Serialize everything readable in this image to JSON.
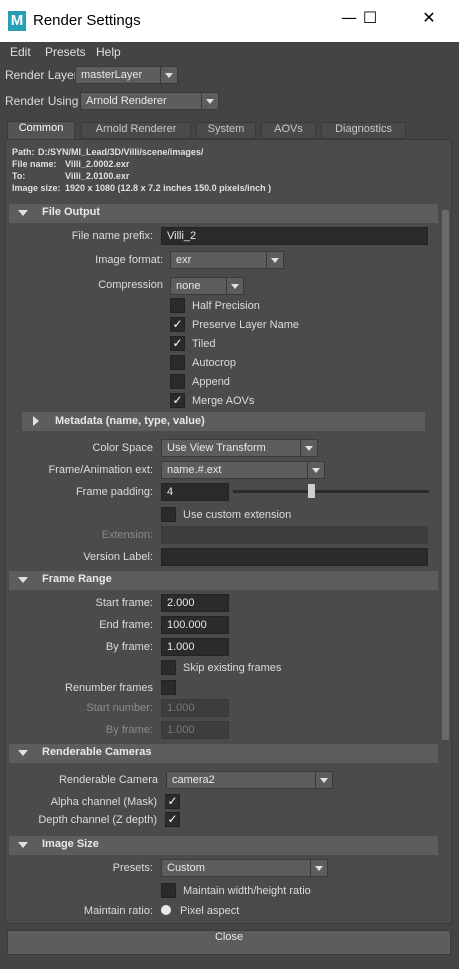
{
  "window": {
    "title": "Render Settings",
    "minimize": "—",
    "maximize": "☐",
    "close": "✕",
    "logo": "M"
  },
  "menu": [
    "Edit",
    "Presets",
    "Help"
  ],
  "render_layer": {
    "label": "Render Layer",
    "value": "masterLayer"
  },
  "render_using": {
    "label": "Render Using",
    "value": "Arnold Renderer"
  },
  "tabs": [
    "Common",
    "Arnold Renderer",
    "System",
    "AOVs",
    "Diagnostics"
  ],
  "info": {
    "path_label": "Path:",
    "path": "D:/SYN/MI_Lead/3D/Villi/scene/images/",
    "filename_label": "File name:",
    "filename": "Villi_2.0002.exr",
    "to_label": "To:",
    "to": "Villi_2.0100.exr",
    "imagesize_label": "Image size:",
    "imagesize": "1920 x 1080 (12.8 x 7.2 inches 150.0 pixels/inch )"
  },
  "file_output": {
    "title": "File Output",
    "prefix_label": "File name prefix:",
    "prefix": "Villi_2",
    "format_label": "Image format:",
    "format": "exr",
    "compression_label": "Compression",
    "compression": "none",
    "checks": [
      {
        "label": "Half Precision",
        "checked": false
      },
      {
        "label": "Preserve Layer Name",
        "checked": true
      },
      {
        "label": "Tiled",
        "checked": true
      },
      {
        "label": "Autocrop",
        "checked": false
      },
      {
        "label": "Append",
        "checked": false
      },
      {
        "label": "Merge AOVs",
        "checked": true
      }
    ],
    "metadata": "Metadata (name, type, value)",
    "colorspace_label": "Color Space",
    "colorspace": "Use View Transform",
    "frameext_label": "Frame/Animation ext:",
    "frameext": "name.#.ext",
    "padding_label": "Frame padding:",
    "padding": "4",
    "padding_slider": 0.4,
    "custom_ext_label": "Use custom extension",
    "extension_label": "Extension:",
    "version_label": "Version Label:"
  },
  "frame_range": {
    "title": "Frame Range",
    "start_label": "Start frame:",
    "start": "2.000",
    "end_label": "End frame:",
    "end": "100.000",
    "by_label": "By frame:",
    "by": "1.000",
    "skip_label": "Skip existing frames",
    "renumber_label": "Renumber frames",
    "start_number_label": "Start number:",
    "start_number": "1.000",
    "by_frame2_label": "By frame:",
    "by_frame2": "1.000"
  },
  "cameras": {
    "title": "Renderable Cameras",
    "camera_label": "Renderable Camera",
    "camera": "camera2",
    "alpha_label": "Alpha channel (Mask)",
    "depth_label": "Depth channel (Z depth)"
  },
  "image_size": {
    "title": "Image Size",
    "presets_label": "Presets:",
    "presets": "Custom",
    "maintain_wh_label": "Maintain width/height ratio",
    "maintain_ratio_label": "Maintain ratio:",
    "pixel_aspect": "Pixel aspect"
  },
  "close_button": "Close",
  "colors": {
    "bg": "#444444",
    "field": "#2b2b2b",
    "section": "#5d5d5d",
    "accent": "#28a0b4"
  }
}
